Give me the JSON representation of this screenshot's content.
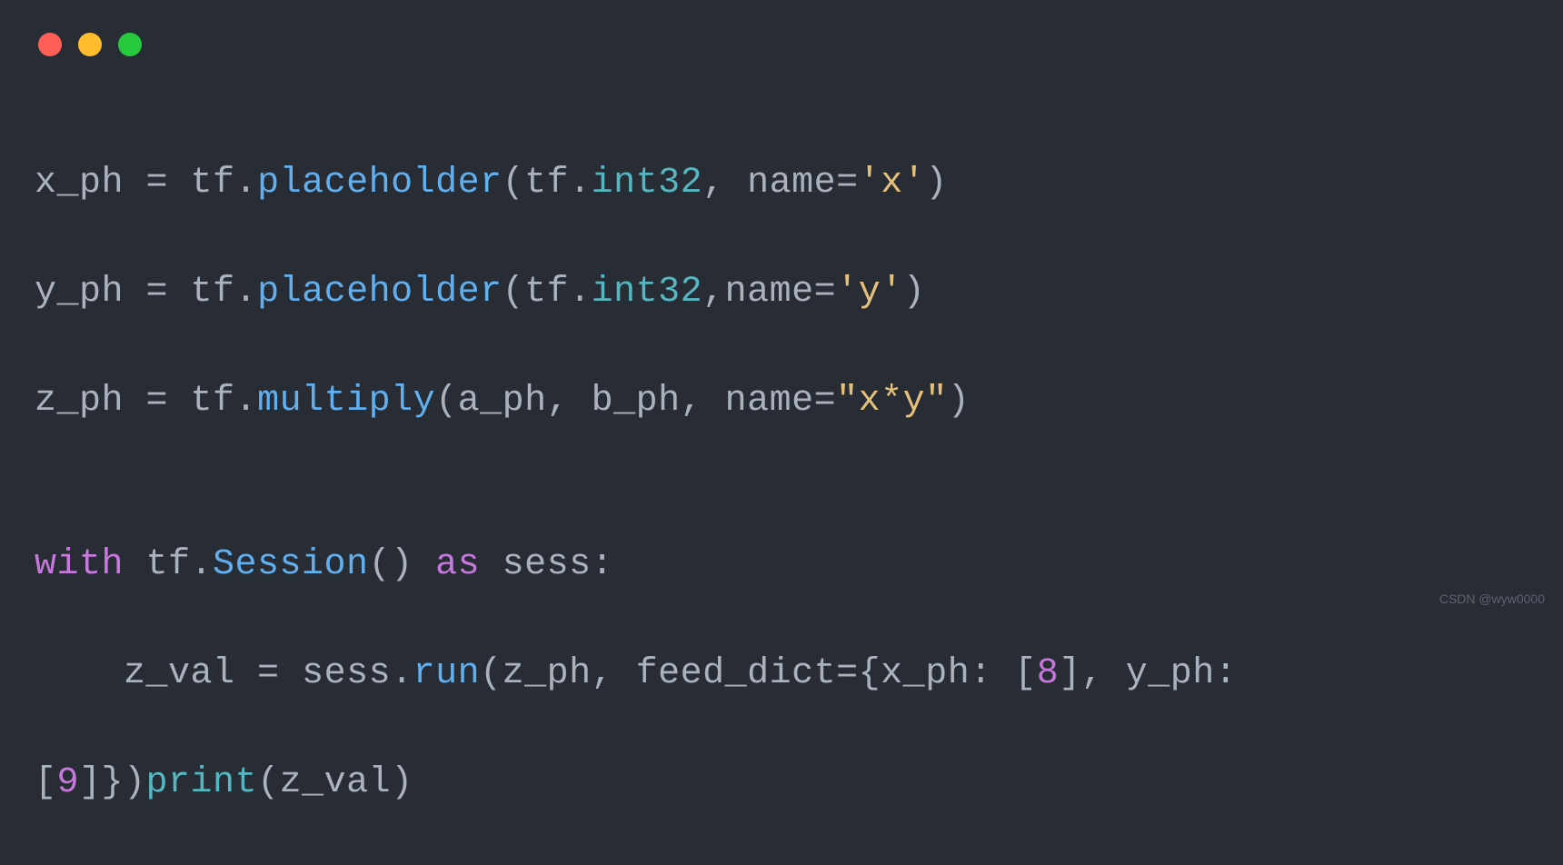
{
  "window": {
    "controls": [
      "close",
      "minimize",
      "maximize"
    ]
  },
  "code": {
    "line1": {
      "t1": "x_ph ",
      "t2": "=",
      "t3": " tf.",
      "t4": "placeholder",
      "t5": "(tf.",
      "t6": "int32",
      "t7": ", name=",
      "t8": "'x'",
      "t9": ")"
    },
    "line2": {
      "t1": "y_ph ",
      "t2": "=",
      "t3": " tf.",
      "t4": "placeholder",
      "t5": "(tf.",
      "t6": "int32",
      "t7": ",name=",
      "t8": "'y'",
      "t9": ")"
    },
    "line3": {
      "t1": "z_ph ",
      "t2": "=",
      "t3": " tf.",
      "t4": "multiply",
      "t5": "(a_ph, b_ph, name=",
      "t6": "\"x*y\"",
      "t7": ")"
    },
    "line4": "",
    "line5": {
      "t1": "with",
      "t2": " tf.",
      "t3": "Session",
      "t4": "() ",
      "t5": "as",
      "t6": " sess:"
    },
    "line6": {
      "t1": "    z_val ",
      "t2": "=",
      "t3": " sess.",
      "t4": "run",
      "t5": "(z_ph, feed_dict={x_ph: [",
      "t6": "8",
      "t7": "], y_ph: "
    },
    "line7": {
      "t1": "[",
      "t2": "9",
      "t3": "]})",
      "t4": "print",
      "t5": "(z_val)"
    }
  },
  "watermark": "CSDN @wyw0000"
}
